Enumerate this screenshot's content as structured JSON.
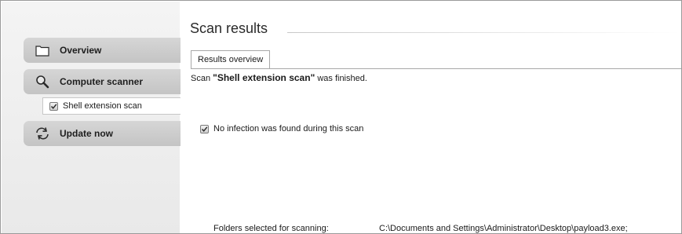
{
  "sidebar": {
    "items": [
      {
        "label": "Overview",
        "icon": "folder-icon"
      },
      {
        "label": "Computer scanner",
        "icon": "magnifier-icon"
      },
      {
        "label": "Update now",
        "icon": "update-icon"
      }
    ],
    "sub_items": [
      {
        "label": "Shell extension scan",
        "icon": "checkbox-checked-icon"
      }
    ]
  },
  "main": {
    "title": "Scan results",
    "tab_label": "Results overview",
    "scan_status": {
      "prefix": "Scan ",
      "open_quote": "\"",
      "scan_name": "Shell extension scan",
      "close_quote": "\"",
      "suffix": " was finished."
    },
    "result_message": "No infection was found during this scan",
    "folders_label": "Folders selected for scanning:",
    "folders_path": "C:\\Documents and Settings\\Administrator\\Desktop\\payload3.exe;"
  },
  "colors": {
    "nav_bg": "#cdcdcd",
    "sidebar_bg": "#eeeeee",
    "accent_text": "#1e1e1e"
  }
}
